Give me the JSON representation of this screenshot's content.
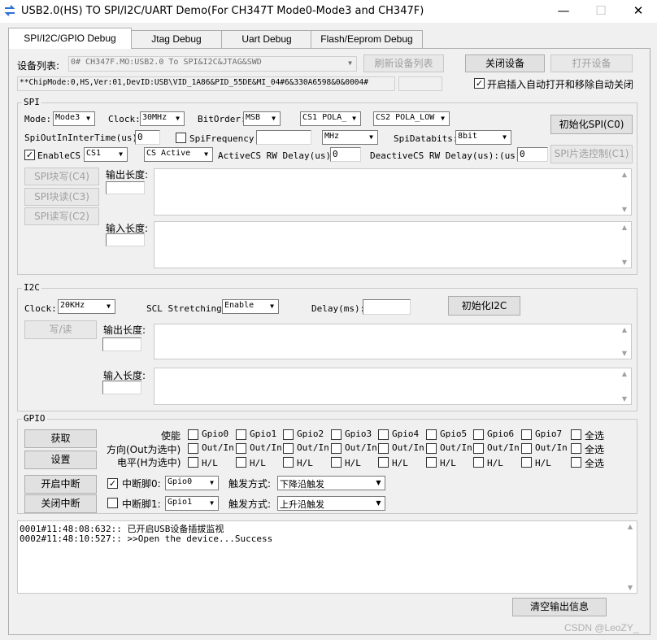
{
  "window": {
    "title": "USB2.0(HS) TO SPI/I2C/UART Demo(For CH347T Mode0-Mode3 and CH347F)",
    "minimize": "—",
    "maximize": "☐",
    "close": "✕"
  },
  "tabs": [
    "SPI/I2C/GPIO Debug",
    "Jtag Debug",
    "Uart Debug",
    "Flash/Eeprom Debug"
  ],
  "device": {
    "list_label": "设备列表:",
    "selected": "0# CH347F.MO:USB2.0 To SPI&I2C&JTAG&SWD",
    "refresh_button": "刷新设备列表",
    "close_button": "关闭设备",
    "open_button": "打开设备",
    "info": "**ChipMode:0,HS,Ver:01,DevID:USB\\VID_1A86&PID_55DE&MI_04#6&330A6598&0&0004#",
    "auto_label": "开启插入自动打开和移除自动关闭",
    "auto_checked": "✓"
  },
  "spi": {
    "group": "SPI",
    "mode_label": "Mode:",
    "mode": "Mode3",
    "clock_label": "Clock:",
    "clock": "30MHz",
    "bitorder_label": "BitOrder:",
    "bitorder": "MSB",
    "cs1_pola": "CS1 POLA_",
    "cs2_pola": "CS2 POLA_LOW",
    "init_button": "初始化SPI(C0)",
    "interval_label": "SpiOutInInterTime(us):",
    "interval": "0",
    "freq_label": "SpiFrequency:",
    "freq": "",
    "freq_unit": "MHz",
    "databits_label": "SpiDatabits:",
    "databits": "8bit",
    "enablecs_label": "EnableCS",
    "enablecs_checked": "✓",
    "cs_select": "CS1",
    "cs_active": "CS Active",
    "active_delay_label": "ActiveCS RW Delay(us):",
    "active_delay": "0",
    "deactive_delay_label": "DeactiveCS RW Delay(us):(us):",
    "deactive_delay": "0",
    "cs_ctrl_button": "SPI片选控制(C1)",
    "block_write_button": "SPI块写(C4)",
    "block_read_button": "SPI块读(C3)",
    "read_write_button": "SPI读写(C2)",
    "out_len_label": "输出长度:",
    "in_len_label": "输入长度:"
  },
  "i2c": {
    "group": "I2C",
    "clock_label": "Clock:",
    "clock": "20KHz",
    "stretch_label": "SCL Stretching:",
    "stretch": "Enable",
    "delay_label": "Delay(ms):",
    "delay": "",
    "init_button": "初始化I2C",
    "rw_button": "写/读",
    "out_len_label": "输出长度:",
    "in_len_label": "输入长度:"
  },
  "gpio": {
    "group": "GPIO",
    "get_button": "获取",
    "set_button": "设置",
    "int_on_button": "开启中断",
    "int_off_button": "关闭中断",
    "enable_label": "使能",
    "dir_label": "方向(Out为选中)",
    "level_label": "电平(H为选中)",
    "pins": [
      "Gpio0",
      "Gpio1",
      "Gpio2",
      "Gpio3",
      "Gpio4",
      "Gpio5",
      "Gpio6",
      "Gpio7"
    ],
    "dir_text": "Out/In",
    "level_text": "H/L",
    "select_all": "全选",
    "int0_label": "中断脚0:",
    "int0_checked": "✓",
    "int0_pin": "Gpio0",
    "int0_trigger_label": "触发方式:",
    "int0_trigger": "下降沿触发",
    "int1_label": "中断脚1:",
    "int1_pin": "Gpio1",
    "int1_trigger_label": "触发方式:",
    "int1_trigger": "上升沿触发"
  },
  "log": {
    "lines": [
      "0001#11:48:08:632:: 已开启USB设备插拔监视",
      "0002#11:48:10:527:: >>Open the device...Success"
    ],
    "clear_button": "清空输出信息"
  },
  "watermark": "CSDN @LeoZY_"
}
